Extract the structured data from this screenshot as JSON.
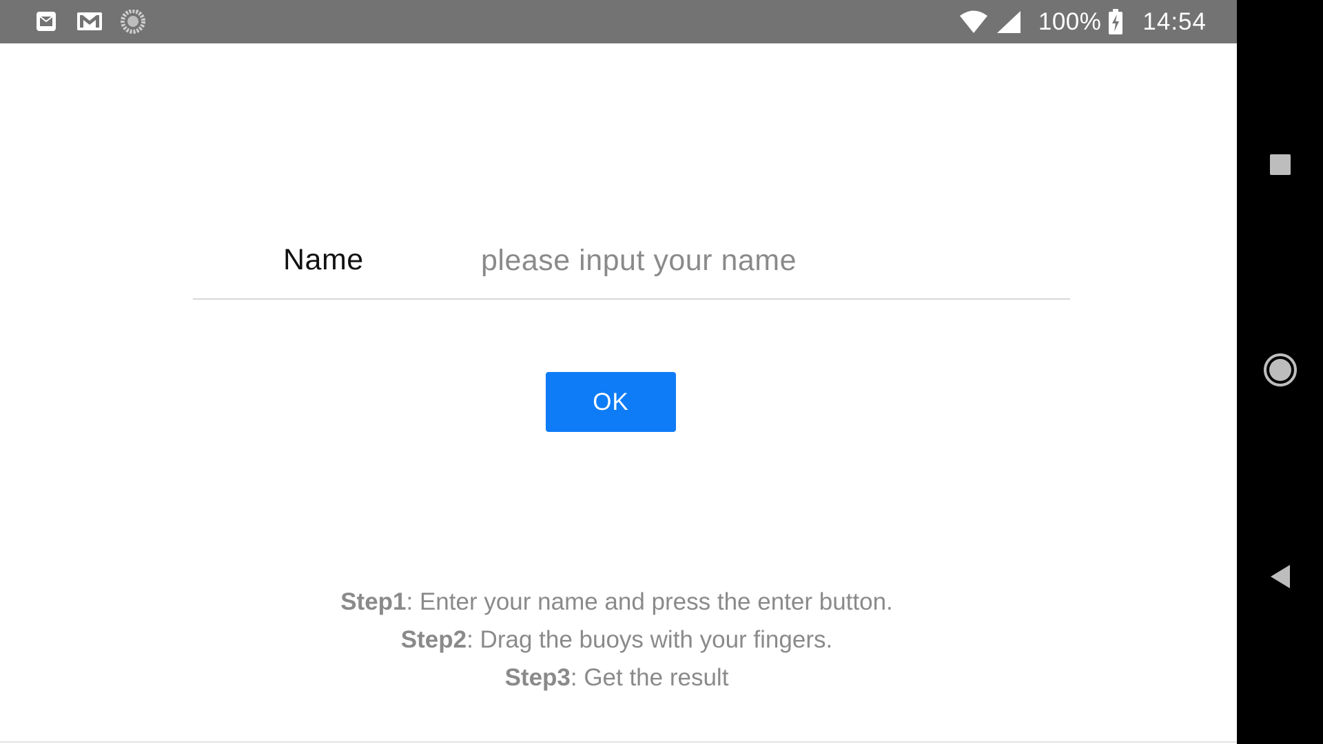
{
  "status_bar": {
    "notification_icons": [
      "email-icon",
      "gmail-icon",
      "sync-icon"
    ],
    "wifi_icon": "wifi-icon",
    "signal_icon": "cell-signal-icon",
    "battery_percent": "100%",
    "battery_icon": "battery-charging-icon",
    "time": "14:54"
  },
  "form": {
    "name_label": "Name",
    "name_placeholder": "please input your name",
    "name_value": "",
    "ok_label": "OK"
  },
  "instructions": [
    {
      "key": "Step1",
      "text": ": Enter your name and press the enter button."
    },
    {
      "key": "Step2",
      "text": ": Drag the buoys with your fingers."
    },
    {
      "key": "Step3",
      "text": ": Get the result"
    }
  ],
  "nav_bar": {
    "buttons": [
      "recents-icon",
      "home-icon",
      "back-icon"
    ]
  },
  "colors": {
    "status_bar_bg": "#737373",
    "accent_button": "#0f7cf7",
    "instruction_text": "#8a8a8a",
    "nav_bar_bg": "#000000"
  }
}
